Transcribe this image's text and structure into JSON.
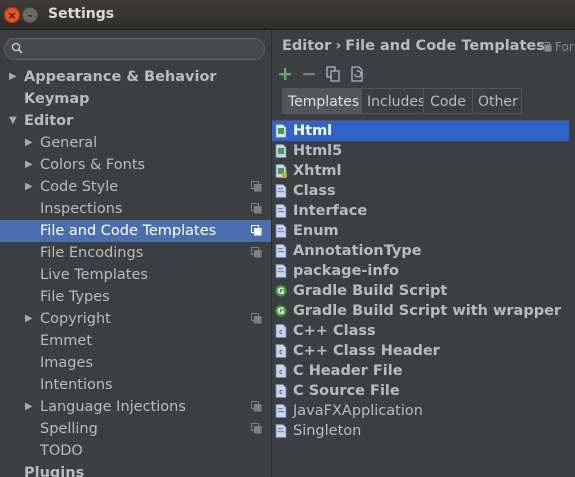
{
  "window": {
    "title": "Settings"
  },
  "search": {
    "value": ""
  },
  "tree": [
    {
      "label": "Appearance & Behavior",
      "bold": true,
      "arrow": "▶",
      "indent": 0,
      "project": false,
      "selected": false
    },
    {
      "label": "Keymap",
      "bold": true,
      "arrow": "",
      "indent": 0,
      "project": false,
      "selected": false
    },
    {
      "label": "Editor",
      "bold": true,
      "arrow": "▼",
      "indent": 0,
      "project": false,
      "selected": false
    },
    {
      "label": "General",
      "bold": false,
      "arrow": "▶",
      "indent": 1,
      "project": false,
      "selected": false
    },
    {
      "label": "Colors & Fonts",
      "bold": false,
      "arrow": "▶",
      "indent": 1,
      "project": false,
      "selected": false
    },
    {
      "label": "Code Style",
      "bold": false,
      "arrow": "▶",
      "indent": 1,
      "project": true,
      "selected": false
    },
    {
      "label": "Inspections",
      "bold": false,
      "arrow": "",
      "indent": 1,
      "project": true,
      "selected": false
    },
    {
      "label": "File and Code Templates",
      "bold": false,
      "arrow": "",
      "indent": 1,
      "project": true,
      "selected": true
    },
    {
      "label": "File Encodings",
      "bold": false,
      "arrow": "",
      "indent": 1,
      "project": true,
      "selected": false
    },
    {
      "label": "Live Templates",
      "bold": false,
      "arrow": "",
      "indent": 1,
      "project": false,
      "selected": false
    },
    {
      "label": "File Types",
      "bold": false,
      "arrow": "",
      "indent": 1,
      "project": false,
      "selected": false
    },
    {
      "label": "Copyright",
      "bold": false,
      "arrow": "▶",
      "indent": 1,
      "project": true,
      "selected": false
    },
    {
      "label": "Emmet",
      "bold": false,
      "arrow": "",
      "indent": 1,
      "project": false,
      "selected": false
    },
    {
      "label": "Images",
      "bold": false,
      "arrow": "",
      "indent": 1,
      "project": false,
      "selected": false
    },
    {
      "label": "Intentions",
      "bold": false,
      "arrow": "",
      "indent": 1,
      "project": false,
      "selected": false
    },
    {
      "label": "Language Injections",
      "bold": false,
      "arrow": "▶",
      "indent": 1,
      "project": true,
      "selected": false
    },
    {
      "label": "Spelling",
      "bold": false,
      "arrow": "",
      "indent": 1,
      "project": true,
      "selected": false
    },
    {
      "label": "TODO",
      "bold": false,
      "arrow": "",
      "indent": 1,
      "project": false,
      "selected": false
    },
    {
      "label": "Plugins",
      "bold": true,
      "arrow": "",
      "indent": 0,
      "project": false,
      "selected": false
    }
  ],
  "breadcrumb": {
    "parent": "Editor",
    "separator": "›",
    "current": "File and Code Templates",
    "scope": "For"
  },
  "toolbar": {
    "icons": [
      "add-icon",
      "remove-icon",
      "copy-icon",
      "reset-icon"
    ]
  },
  "tabs": [
    {
      "label": "Templates",
      "active": true
    },
    {
      "label": "Includes",
      "active": false
    },
    {
      "label": "Code",
      "active": false
    },
    {
      "label": "Other",
      "active": false
    }
  ],
  "templates": [
    {
      "name": "Html",
      "icon": "html",
      "bold": true,
      "selected": true
    },
    {
      "name": "Html5",
      "icon": "html",
      "bold": true,
      "selected": false
    },
    {
      "name": "Xhtml",
      "icon": "xhtml",
      "bold": true,
      "selected": false
    },
    {
      "name": "Class",
      "icon": "java",
      "bold": true,
      "selected": false
    },
    {
      "name": "Interface",
      "icon": "java",
      "bold": true,
      "selected": false
    },
    {
      "name": "Enum",
      "icon": "java",
      "bold": true,
      "selected": false
    },
    {
      "name": "AnnotationType",
      "icon": "java",
      "bold": true,
      "selected": false
    },
    {
      "name": "package-info",
      "icon": "java",
      "bold": true,
      "selected": false
    },
    {
      "name": "Gradle Build Script",
      "icon": "gradle",
      "bold": true,
      "selected": false
    },
    {
      "name": "Gradle Build Script with wrapper",
      "icon": "gradle",
      "bold": true,
      "selected": false
    },
    {
      "name": "C++ Class",
      "icon": "cpp",
      "bold": true,
      "selected": false
    },
    {
      "name": "C++ Class Header",
      "icon": "cpp",
      "bold": true,
      "selected": false
    },
    {
      "name": "C Header File",
      "icon": "cpp",
      "bold": true,
      "selected": false
    },
    {
      "name": "C Source File",
      "icon": "cpp",
      "bold": true,
      "selected": false
    },
    {
      "name": "JavaFXApplication",
      "icon": "java",
      "bold": false,
      "selected": false
    },
    {
      "name": "Singleton",
      "icon": "java",
      "bold": false,
      "selected": false
    }
  ],
  "colors": {
    "tree_selection": "#4b6eaf",
    "list_selection": "#2f65ca",
    "add_green": "#59a869",
    "gradle_green": "#3e9b3e"
  }
}
